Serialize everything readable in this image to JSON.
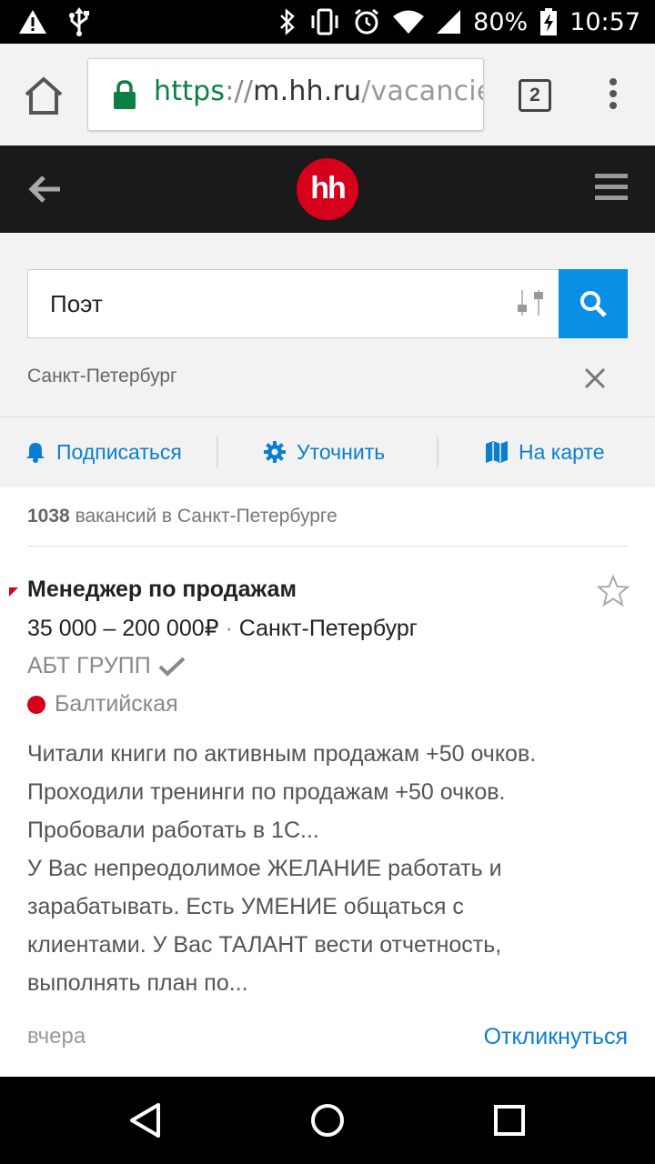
{
  "status_bar": {
    "battery": "80%",
    "time": "10:57"
  },
  "browser": {
    "url_scheme": "https",
    "url_separator": "://",
    "url_host": "m.hh.ru",
    "url_path": "/vacancie",
    "tab_count": "2"
  },
  "header": {
    "logo_text": "hh"
  },
  "search": {
    "query": "Поэт",
    "region": "Санкт-Петербург"
  },
  "actions": {
    "subscribe": "Подписаться",
    "refine": "Уточнить",
    "map": "На карте"
  },
  "results": {
    "count": "1038",
    "count_suffix": "вакансий в Санкт-Петербурге"
  },
  "vacancy": {
    "title": "Менеджер по продажам",
    "salary": "35 000 – 200 000₽",
    "salary_sep": "·",
    "city": "Санкт-Петербург",
    "company": "АБТ ГРУПП",
    "metro": "Балтийская",
    "description_lines": [
      "Читали книги по активным продажам +50 очков.",
      "Проходили тренинги по продажам +50 очков.",
      "Пробовали работать в 1С...",
      "У Вас непреодолимое ЖЕЛАНИЕ работать и",
      "зарабатывать. Есть УМЕНИЕ общаться с",
      "клиентами. У Вас ТАЛАНТ вести отчетность,",
      "выполнять план по..."
    ],
    "date": "вчера",
    "respond_label": "Откликнуться"
  },
  "colors": {
    "brand_red": "#d6001c",
    "link_blue": "#0a7fd1",
    "search_blue": "#0a8fe6",
    "header_dark": "#1a1a1a"
  }
}
